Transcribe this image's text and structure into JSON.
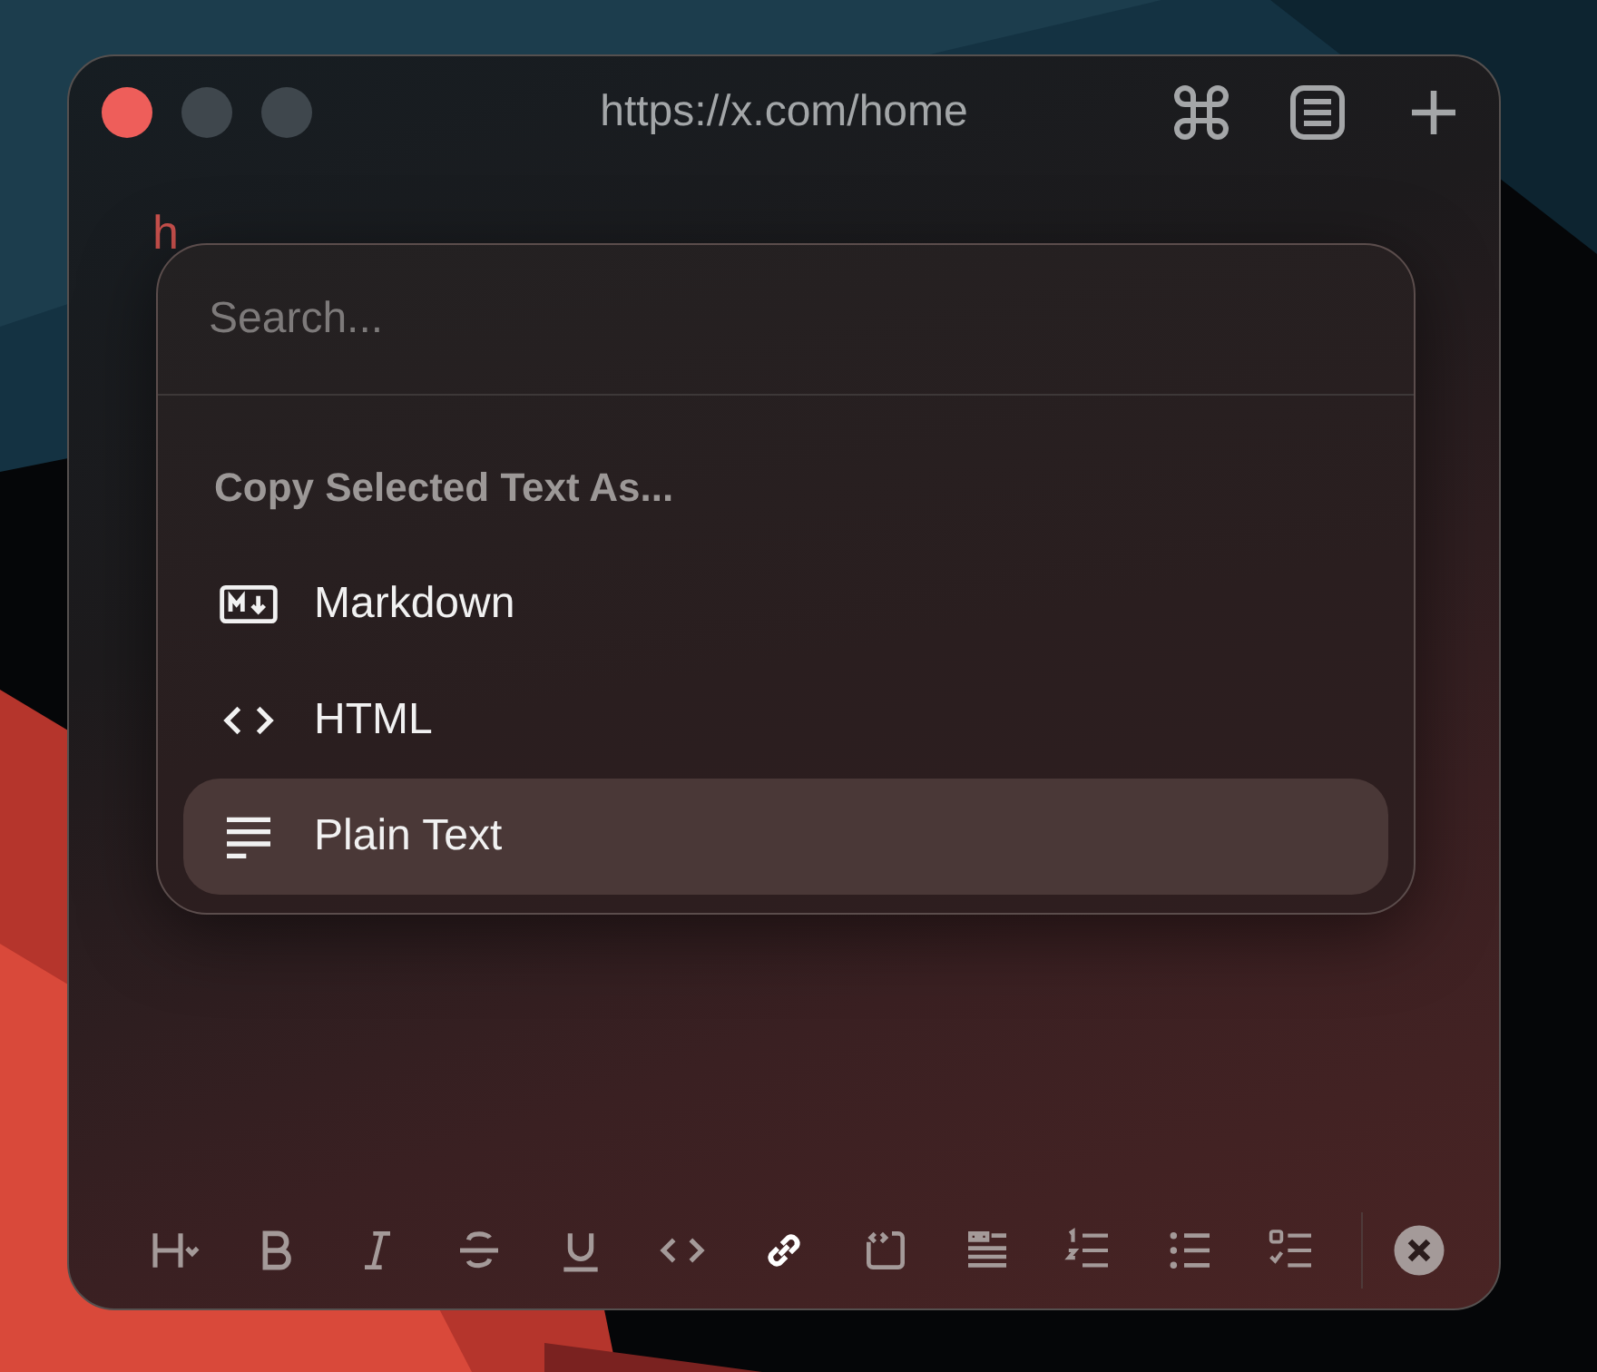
{
  "window": {
    "title": "https://x.com/home",
    "controls": [
      {
        "color": "#ee5e5a"
      },
      {
        "color": "#3f474d"
      },
      {
        "color": "#3f474d"
      }
    ],
    "actions": [
      {
        "kind": "command"
      },
      {
        "kind": "reader"
      },
      {
        "kind": "add"
      }
    ]
  },
  "editor": {
    "text": "h"
  },
  "popup": {
    "search": {
      "placeholder": "Search..."
    },
    "section_title": "Copy Selected Text As...",
    "items": [
      {
        "kind": "markdown",
        "label": "Markdown",
        "selected": false
      },
      {
        "kind": "html",
        "label": "HTML",
        "selected": false
      },
      {
        "kind": "plain",
        "label": "Plain Text",
        "selected": true
      }
    ]
  },
  "toolbar": [
    {
      "kind": "heading",
      "active": false
    },
    {
      "kind": "bold",
      "active": false
    },
    {
      "kind": "italic",
      "active": false
    },
    {
      "kind": "strike",
      "active": false
    },
    {
      "kind": "underline",
      "active": false
    },
    {
      "kind": "code",
      "active": false
    },
    {
      "kind": "link",
      "active": true
    },
    {
      "kind": "codeblock",
      "active": false
    },
    {
      "kind": "quote",
      "active": false
    },
    {
      "kind": "ordered",
      "active": false
    },
    {
      "kind": "bullet",
      "active": false
    },
    {
      "kind": "task",
      "active": false
    },
    {
      "kind": "close",
      "active": false
    }
  ]
}
